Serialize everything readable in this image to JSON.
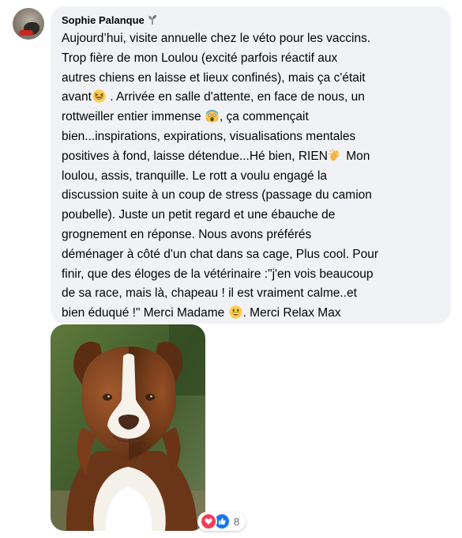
{
  "comment": {
    "author": "Sophie Palanque",
    "author_badge_icon": "seedling-icon",
    "lines": [
      "Aujourd’hui, visite annuelle chez le véto pour les vaccins.",
      "Trop fière de mon Loulou (excité parfois réactif aux",
      "autres chiens en laisse et lieux confinés), mais ça c'était",
      "avant",
      " . Arrivée en salle d'attente, en face de nous, un",
      "rottweiller entier immense ",
      ", ça commençait",
      "bien...inspirations, expirations, visualisations mentales",
      "positives à fond, laisse détendue...Hé bien, RIEN",
      " Mon",
      "loulou, assis, tranquille. Le rott a voulu engagé la",
      "discussion suite à un coup de stress (passage du camion",
      "poubelle). Juste un petit regard et une ébauche de",
      "grognement en réponse. Nous avons préférés",
      "déménager à côté d'un chat dans sa cage, Plus cool. Pour",
      "finir, que des éloges de la vétérinaire :\"j'en vois beaucoup",
      "de sa race, mais là, chapeau ! il est vraiment calme..et",
      "bien éduqué !\" Merci Madame ",
      ". Merci Relax Max"
    ],
    "emojis": {
      "laughing": "grinning-squinting-face-icon",
      "screaming": "face-screaming-in-fear-icon",
      "clapping": "clapping-hands-icon",
      "grinning": "grinning-face-icon"
    },
    "photo_subject": "dog-photo",
    "reactions": {
      "icons": [
        "love-reaction-icon",
        "like-reaction-icon"
      ],
      "count": "8"
    }
  },
  "colors": {
    "bubble_bg": "#f0f2f5",
    "text": "#050505",
    "secondary_text": "#65676b",
    "like_blue": "#1877f2",
    "love_red": "#f33e58"
  }
}
